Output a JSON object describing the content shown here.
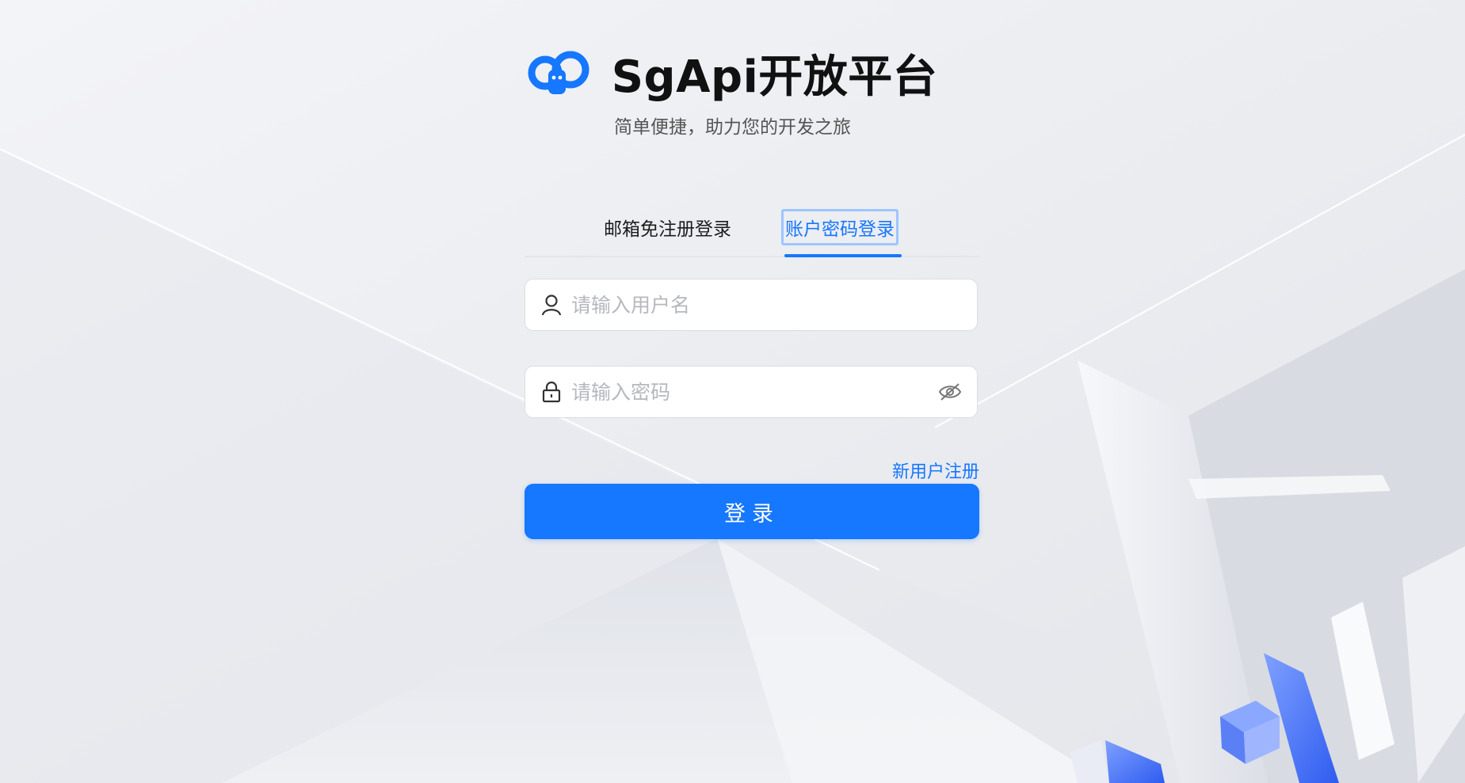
{
  "header": {
    "title": "SgApi开放平台",
    "subtitle": "简单便捷，助力您的开发之旅"
  },
  "tabs": [
    {
      "label": "邮箱免注册登录",
      "active": false
    },
    {
      "label": "账户密码登录",
      "active": true
    }
  ],
  "form": {
    "username": {
      "placeholder": "请输入用户名",
      "value": "",
      "icon": "user-icon"
    },
    "password": {
      "placeholder": "请输入密码",
      "value": "",
      "icon": "lock-icon",
      "toggle_icon": "eye-off-icon"
    },
    "register_link": "新用户注册",
    "login_button": "登录"
  },
  "colors": {
    "accent": "#1677ff",
    "background": "#eceef2",
    "title": "#111111",
    "placeholder": "#b5b8bd"
  }
}
